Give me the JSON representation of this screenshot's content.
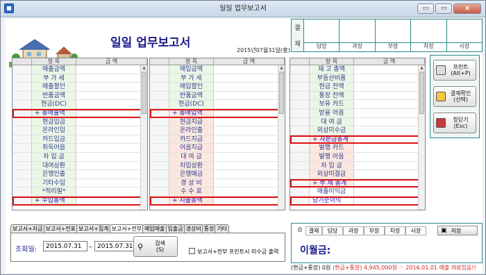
{
  "window": {
    "title": "일일 업무보고서",
    "btn_min": "▭",
    "btn_max": "▭",
    "btn_close": "x"
  },
  "header": {
    "title": "일일 업무보고서",
    "date": "2015년07월31일(金)"
  },
  "approval": {
    "label_top": "결",
    "label_bottom": "재",
    "roles": [
      "담당",
      "과장",
      "부장",
      "차장",
      "사장"
    ]
  },
  "grid_header": {
    "item": "항   목",
    "amount": "금   액"
  },
  "grid1": {
    "items": [
      "매출금액",
      "부 가 세",
      "매출할인",
      "반품금액",
      "현금(DC)",
      "+ 총매출액",
      "현금입금",
      "온라인입",
      "카드입금",
      "취득어음",
      "차 입 금",
      "대여상환",
      "은행인출",
      "기타수입",
      "*적리필*",
      "+ 수입총액"
    ]
  },
  "grid2": {
    "items": [
      "매입금액",
      "부 가 세",
      "매입할인",
      "반품금액",
      "현금(DC)",
      "+ 총매입액",
      "현금지급",
      "온라인출",
      "카드지급",
      "어음지급",
      "대 여 금",
      "차입상환",
      "은행예금",
      "경 상 비",
      "수 수 료",
      "+ 지출총액"
    ]
  },
  "grid3": {
    "items": [
      "재 고 총액",
      "부동산비품",
      "현금 잔액",
      "통장 잔액",
      "보유 카드",
      "받을 어음",
      "대 여 금",
      "외상미수금",
      "+ 자본금총계",
      "발행 카드",
      "발행 어음",
      "차 입 금",
      "외상미결금",
      "+ 부 채 총계",
      "매출이익금",
      "당기순이익"
    ]
  },
  "side": {
    "print_label": "프린트\n(Alt+P)",
    "confirm_label": "결재확인\n(선택)",
    "close_label": "창닫기\n(Esc)"
  },
  "tabs": [
    "보고서+자금",
    "보고서+전표",
    "보고서+집계",
    "보고서+전부",
    "매입매출",
    "입출금",
    "경상비",
    "통장",
    "기타"
  ],
  "search": {
    "label": "조회일:",
    "from": "2015.07.31",
    "sep": "_",
    "to": "2015.07.31",
    "button": "검색\n(S)",
    "checkbox": "보고서+전부 프린트시 미수금 출력"
  },
  "bottom": {
    "print_icon": "printer-icon",
    "approval_row": [
      "결재",
      "담당",
      "과장",
      "부장",
      "차장",
      "사장"
    ],
    "save_label": "저장",
    "carry_over": "이월금:",
    "footer_left": "(현금+통장) 0원",
    "footer_mid": "(현금+통장) 4,945,000원",
    "footer_right": "☞ 2016.01.01 매출 자료있음!!"
  }
}
